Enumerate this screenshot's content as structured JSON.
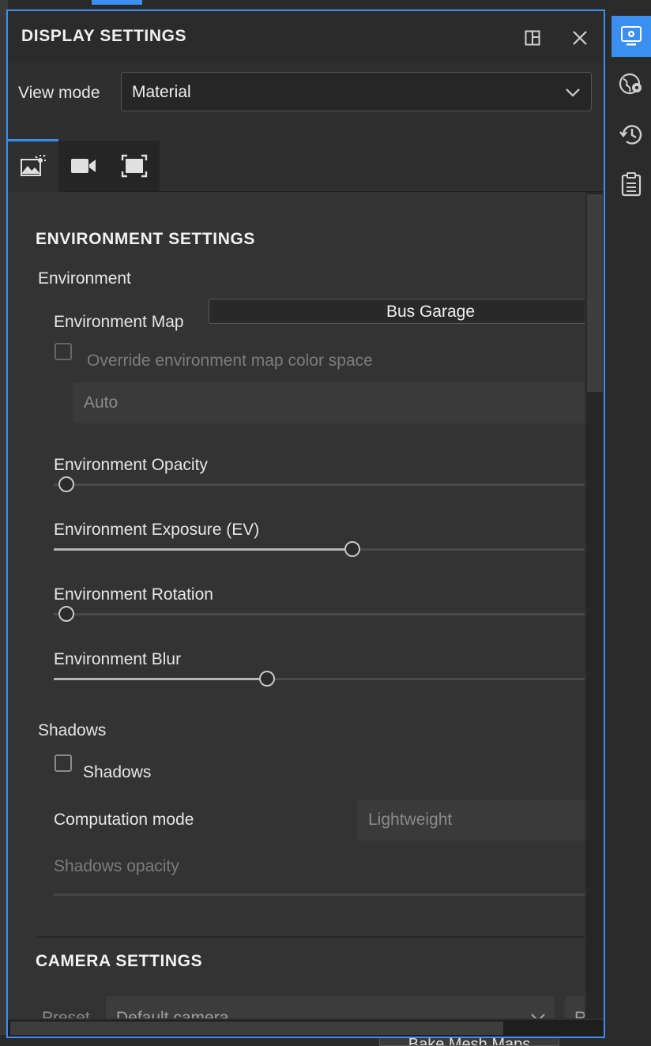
{
  "panel": {
    "title": "DISPLAY SETTINGS"
  },
  "view_mode": {
    "label": "View mode",
    "value": "Material"
  },
  "tabs": [
    {
      "name": "environment-tab",
      "icon": "image-sun-icon",
      "active": true
    },
    {
      "name": "camera-tab",
      "icon": "video-camera-icon",
      "active": false
    },
    {
      "name": "viewport-tab",
      "icon": "frame-icon",
      "active": false
    }
  ],
  "environment_settings": {
    "title": "ENVIRONMENT SETTINGS",
    "group_environment": "Environment",
    "environment_map_label": "Environment Map",
    "environment_map_value": "Bus Garage",
    "override_label": "Override environment map color space",
    "override_checked": false,
    "color_space_value": "Auto",
    "opacity_label": "Environment Opacity",
    "opacity_value": 0.0,
    "exposure_label": "Environment Exposure (EV)",
    "exposure_value": 0.5,
    "rotation_label": "Environment Rotation",
    "rotation_value": 0.0,
    "blur_label": "Environment Blur",
    "blur_value": 0.36,
    "group_shadows": "Shadows",
    "shadows_label": "Shadows",
    "shadows_checked": false,
    "computation_label": "Computation mode",
    "computation_value": "Lightweight",
    "shadows_opacity_label": "Shadows opacity"
  },
  "camera_settings": {
    "title": "CAMERA SETTINGS",
    "preset_label": "Preset",
    "preset_value": "Default camera",
    "extra_button": "R"
  },
  "background": {
    "bottom_button": "Bake Mesh Maps"
  },
  "rail": [
    {
      "name": "display-settings-rail-button",
      "icon": "monitor-gear-icon",
      "active": true
    },
    {
      "name": "globe-settings-rail-button",
      "icon": "globe-gear-icon",
      "active": false
    },
    {
      "name": "history-rail-button",
      "icon": "history-icon",
      "active": false
    },
    {
      "name": "log-rail-button",
      "icon": "clipboard-list-icon",
      "active": false
    }
  ],
  "colors": {
    "accent": "#3b8ff0",
    "panel_bg": "#2f2f2f",
    "content_bg": "#333333"
  }
}
